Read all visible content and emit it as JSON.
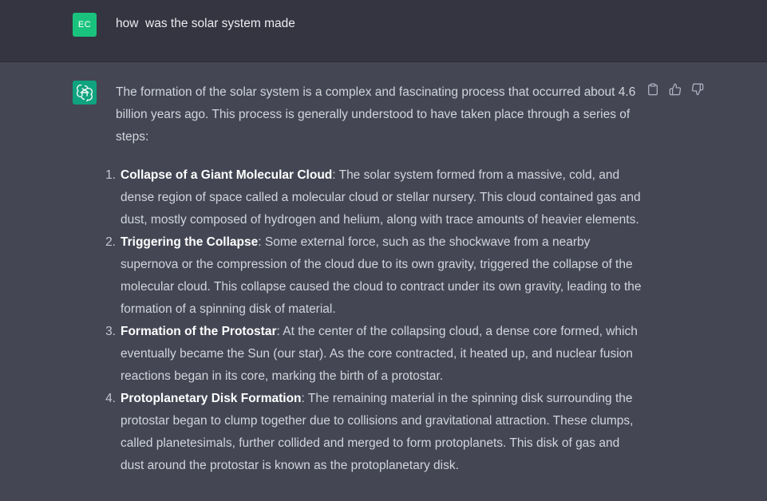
{
  "user": {
    "initials": "EC",
    "message": "how  was the solar system made"
  },
  "assistant": {
    "intro": "The formation of the solar system is a complex and fascinating process that occurred about 4.6 billion years ago. This process is generally understood to have taken place through a series of steps:",
    "steps": [
      {
        "number": "1.",
        "title": "Collapse of a Giant Molecular Cloud",
        "text": ": The solar system formed from a massive, cold, and dense region of space called a molecular cloud or stellar nursery. This cloud contained gas and dust, mostly composed of hydrogen and helium, along with trace amounts of heavier elements."
      },
      {
        "number": "2.",
        "title": "Triggering the Collapse",
        "text": ": Some external force, such as the shockwave from a nearby supernova or the compression of the cloud due to its own gravity, triggered the collapse of the molecular cloud. This collapse caused the cloud to contract under its own gravity, leading to the formation of a spinning disk of material."
      },
      {
        "number": "3.",
        "title": "Formation of the Protostar",
        "text": ": At the center of the collapsing cloud, a dense core formed, which eventually became the Sun (our star). As the core contracted, it heated up, and nuclear fusion reactions began in its core, marking the birth of a protostar."
      },
      {
        "number": "4.",
        "title": "Protoplanetary Disk Formation",
        "text": ": The remaining material in the spinning disk surrounding the protostar began to clump together due to collisions and gravitational attraction. These clumps, called planetesimals, further collided and merged to form protoplanets. This disk of gas and dust around the protostar is known as the protoplanetary disk."
      }
    ]
  },
  "icons": {
    "copy": "clipboard-icon",
    "like": "thumbs-up-icon",
    "dislike": "thumbs-down-icon"
  },
  "colors": {
    "user_bg": "#343541",
    "assistant_bg": "#444654",
    "user_avatar": "#19c37d",
    "gpt_avatar": "#10a37f"
  }
}
